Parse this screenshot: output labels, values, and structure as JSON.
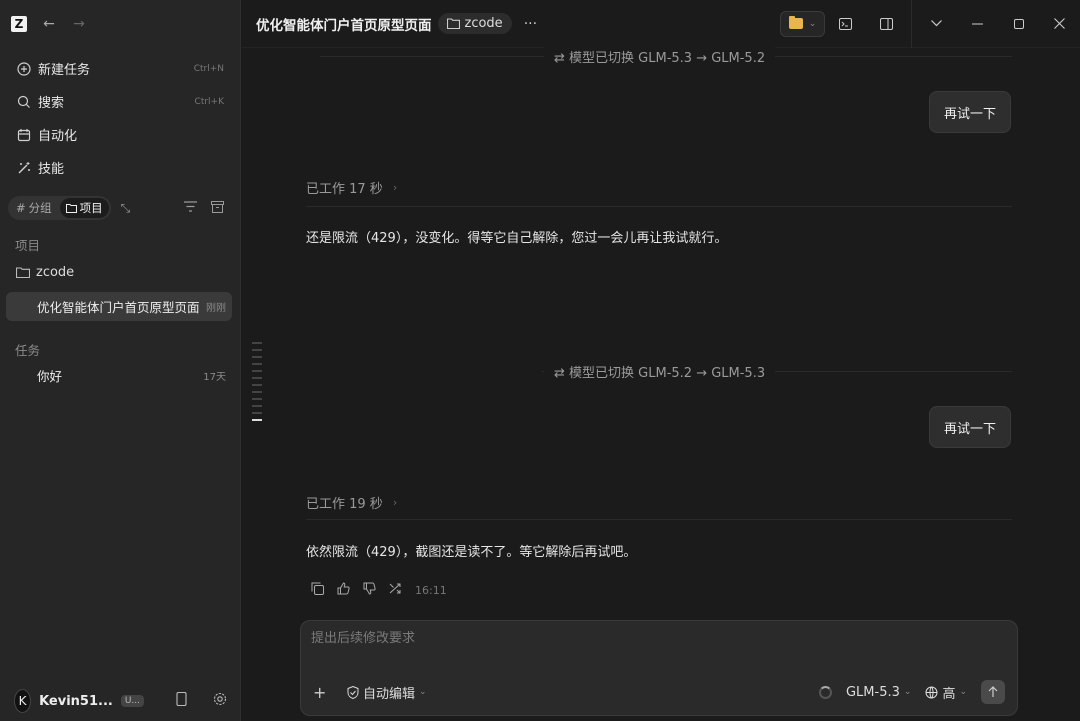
{
  "sidebar": {
    "menu": [
      {
        "label": "新建任务",
        "shortcut": "Ctrl+N",
        "icon": "plus-circle-icon"
      },
      {
        "label": "搜索",
        "shortcut": "Ctrl+K",
        "icon": "search-icon"
      },
      {
        "label": "自动化",
        "shortcut": "",
        "icon": "calendar-icon"
      },
      {
        "label": "技能",
        "shortcut": "",
        "icon": "wand-icon"
      }
    ],
    "filter": {
      "group": "分组",
      "project": "项目"
    },
    "projects_label": "项目",
    "project_name": "zcode",
    "active_task": {
      "title": "优化智能体门户首页原型页面",
      "time": "刚刚"
    },
    "tasks_label": "任务",
    "tasks": [
      {
        "title": "你好",
        "time": "17天"
      }
    ],
    "user": {
      "initial": "K",
      "name": "Kevin51...",
      "badge": "U..."
    }
  },
  "topbar": {
    "title": "优化智能体门户首页原型页面",
    "project_chip": "zcode",
    "more": "···"
  },
  "conversation": {
    "switch1": "⇄ 模型已切换 GLM-5.3 → GLM-5.2",
    "user_msg1": "再试一下",
    "worked1": "已工作 17 秒",
    "reply1": "还是限流（429），没变化。得等它自己解除，您过一会儿再让我试就行。",
    "switch2": "⇄ 模型已切换 GLM-5.2 → GLM-5.3",
    "user_msg2": "再试一下",
    "worked2": "已工作 19 秒",
    "reply2": "依然限流（429），截图还是读不了。等它解除后再试吧。",
    "reply2_time": "16:11"
  },
  "composer": {
    "placeholder": "提出后续修改要求",
    "mode": "自动编辑",
    "model": "GLM-5.3",
    "level": "高"
  },
  "colors": {
    "background": "#1b1b1b",
    "sidebar": "#262626",
    "bubble": "#2e2e2e",
    "folder": "#e8b64c"
  }
}
